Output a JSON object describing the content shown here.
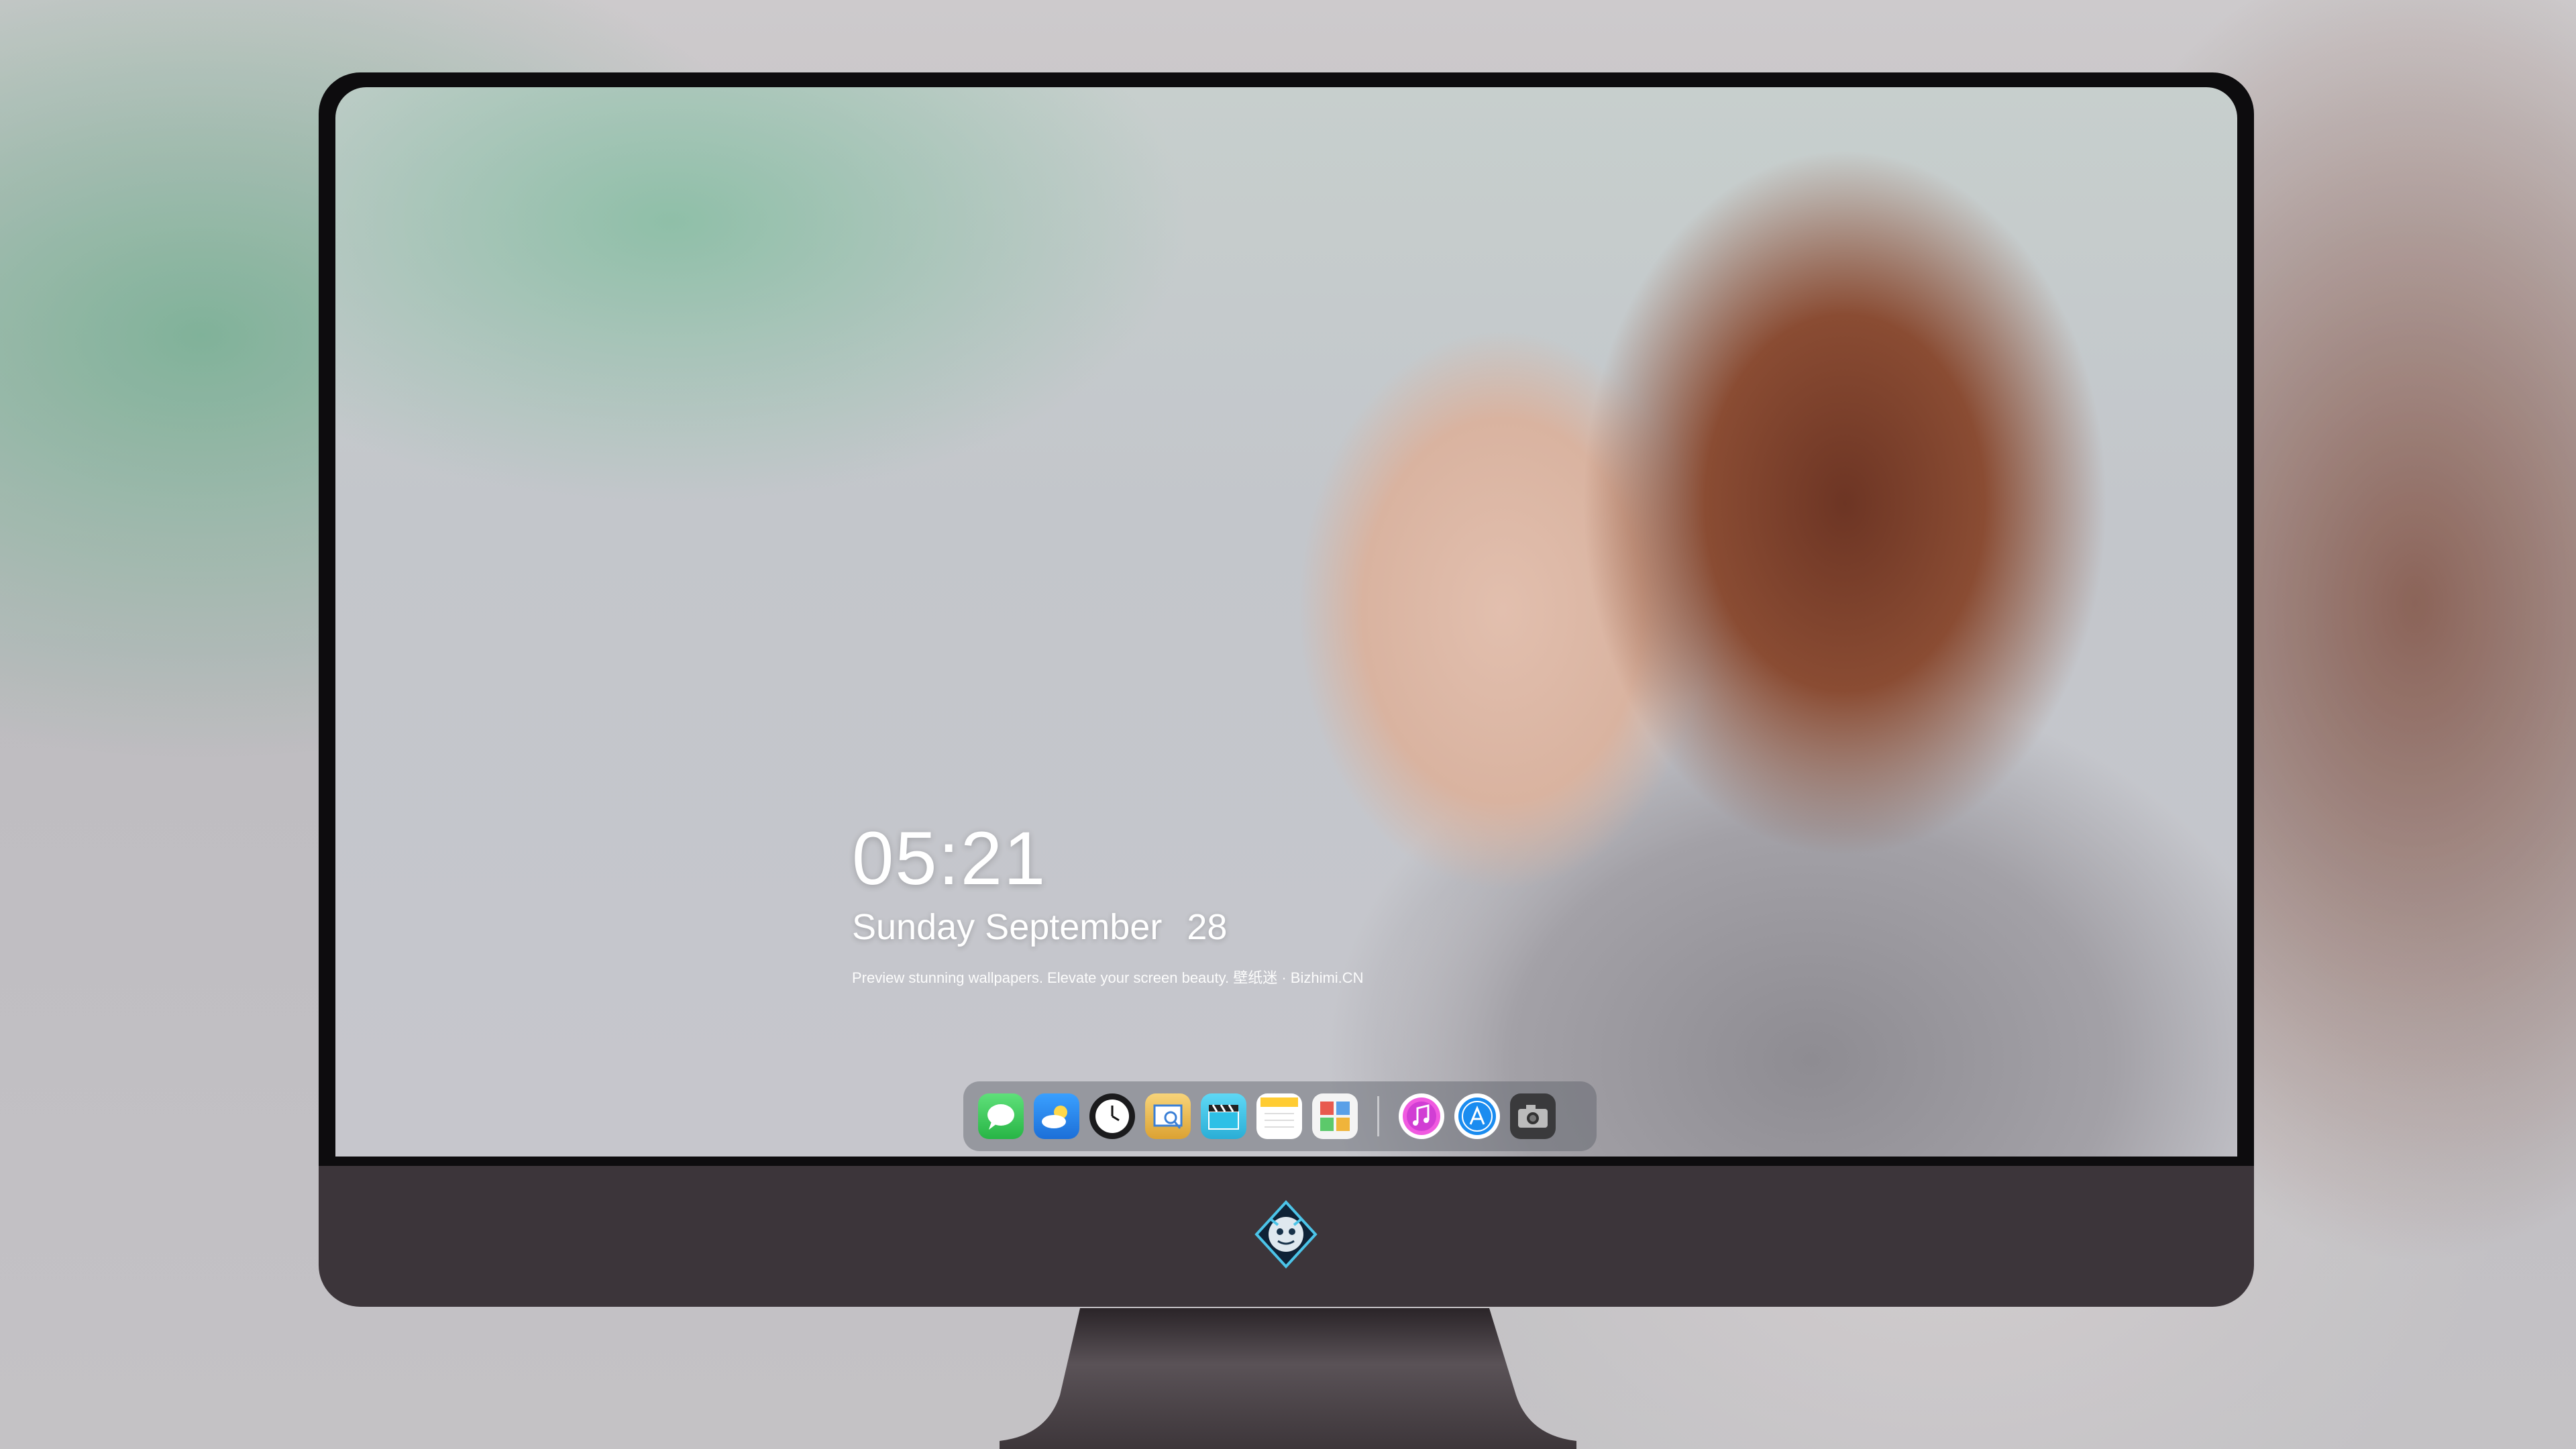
{
  "lockscreen": {
    "time": "05:21",
    "date": {
      "weekday": "Sunday",
      "month": "September",
      "day": "28"
    },
    "tagline": "Preview stunning wallpapers. Elevate your screen beauty. 壁纸迷 · Bizhimi.CN"
  },
  "dock": {
    "apps": [
      {
        "name": "messages-icon",
        "color": "#34c759"
      },
      {
        "name": "weather-icon",
        "color": "#2e8cf0"
      },
      {
        "name": "clock-icon",
        "color": "#1a1a1a"
      },
      {
        "name": "preview-icon",
        "color": "#e9b43a"
      },
      {
        "name": "movie-clapper-icon",
        "color": "#38c3e6"
      },
      {
        "name": "notes-icon",
        "color": "#ffcc33"
      },
      {
        "name": "photo-booth-icon",
        "color": "#5aa0e8"
      }
    ],
    "apps_right": [
      {
        "name": "itunes-icon",
        "color": "#e84ad8"
      },
      {
        "name": "app-store-icon",
        "color": "#1a8cf0"
      },
      {
        "name": "camera-icon",
        "color": "#3a3a3c"
      }
    ]
  },
  "colors": {
    "bezel": "#0d0c0e",
    "chin": "#3c353a",
    "stand": "#4a4247"
  }
}
